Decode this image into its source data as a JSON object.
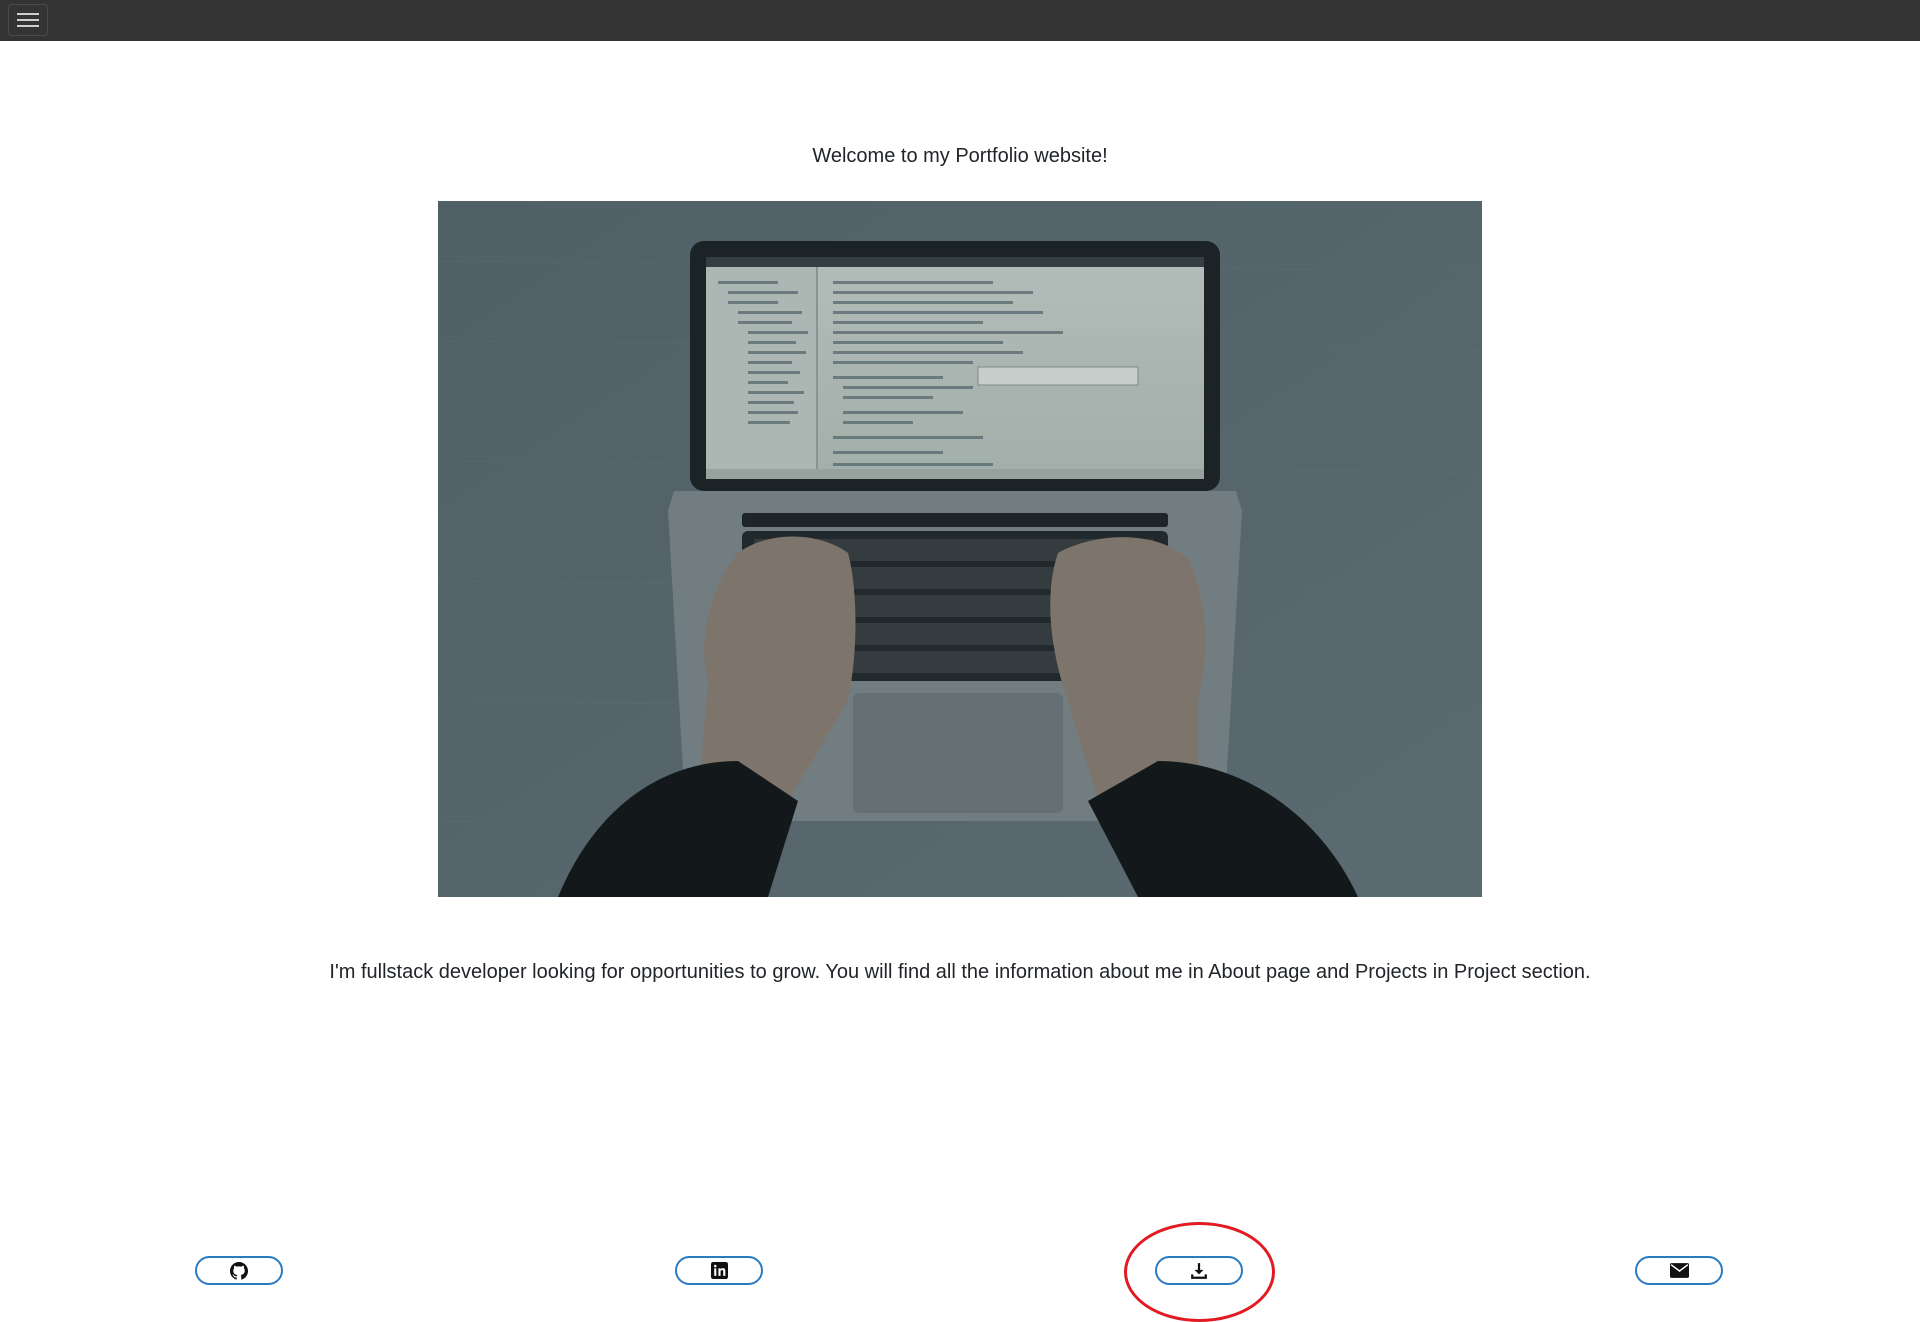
{
  "navbar": {
    "toggle_icon": "hamburger-menu-icon",
    "background": "#343434"
  },
  "main": {
    "welcome_text": "Welcome to my Portfolio website!",
    "intro_text": "I'm fullstack developer looking for opportunities to grow. You will find all the information about me in About page and Projects in Project section."
  },
  "social_links": [
    {
      "icon": "github-icon"
    },
    {
      "icon": "linkedin-icon"
    },
    {
      "icon": "download-icon"
    },
    {
      "icon": "envelope-icon"
    }
  ],
  "colors": {
    "accent": "#2b7bc0",
    "highlight": "#e11b22",
    "text": "#212529"
  }
}
